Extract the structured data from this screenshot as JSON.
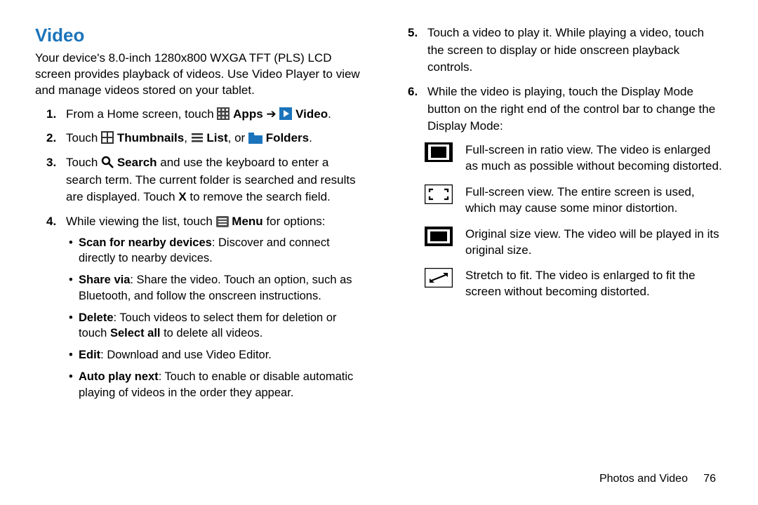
{
  "title": "Video",
  "intro": "Your device's 8.0-inch 1280x800 WXGA TFT (PLS) LCD screen provides playback of videos. Use Video Player to view and manage videos stored on your tablet.",
  "step1_a": "From a Home screen, touch ",
  "step1_apps": "Apps",
  "step1_arrow": " ➔ ",
  "step1_video": "Video",
  "step1_end": ".",
  "step2_a": "Touch ",
  "step2_thumb": "Thumbnails",
  "step2_sep1": ", ",
  "step2_list": "List",
  "step2_sep2": ", or ",
  "step2_folders": "Folders",
  "step2_end": ".",
  "step3_a": "Touch ",
  "step3_search": "Search",
  "step3_rest": " and use the keyboard to enter a search term. The current folder is searched and results are displayed. Touch ",
  "step3_x": "X",
  "step3_end": " to remove the search field.",
  "step4_a": "While viewing the list, touch ",
  "step4_menu": "Menu",
  "step4_end": " for options:",
  "sub_scan_b": "Scan for nearby devices",
  "sub_scan_t": ": Discover and connect directly to nearby devices.",
  "sub_share_b": "Share via",
  "sub_share_t": ": Share the video. Touch an option, such as Bluetooth, and follow the onscreen instructions.",
  "sub_delete_b": "Delete",
  "sub_delete_t1": ": Touch videos to select them for deletion or touch ",
  "sub_delete_sa": "Select all",
  "sub_delete_t2": " to delete all videos.",
  "sub_edit_b": "Edit",
  "sub_edit_t": ": Download and use Video Editor.",
  "sub_auto_b": "Auto play next",
  "sub_auto_t": ": Touch to enable or disable automatic playing of videos in the order they appear.",
  "step5": "Touch a video to play it. While playing a video, touch the screen to display or hide onscreen playback controls.",
  "step6": "While the video is playing, touch the Display Mode button on the right end of the control bar to change the Display Mode:",
  "mode1": "Full-screen in ratio view. The video is enlarged as much as possible without becoming distorted.",
  "mode2": "Full-screen view. The entire screen is used, which may cause some minor distortion.",
  "mode3": "Original size view. The video will be played in its original size.",
  "mode4": "Stretch to fit. The video is enlarged to fit the screen without becoming distorted.",
  "footer_section": "Photos and Video",
  "footer_page": "76"
}
